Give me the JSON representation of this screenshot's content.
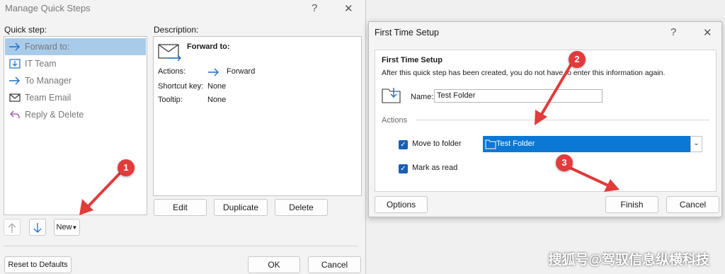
{
  "manage_dialog": {
    "title": "Manage Quick Steps",
    "help": "?",
    "close": "✕",
    "quick_step_label": "Quick step:",
    "description_label": "Description:",
    "quick_steps": [
      {
        "label": "Forward to:",
        "icon": "forward-arrow-icon"
      },
      {
        "label": "IT Team",
        "icon": "move-to-folder-icon"
      },
      {
        "label": "To Manager",
        "icon": "forward-arrow-icon"
      },
      {
        "label": "Team Email",
        "icon": "envelope-icon"
      },
      {
        "label": "Reply & Delete",
        "icon": "reply-icon"
      }
    ],
    "description": {
      "title": "Forward to:",
      "actions_label": "Actions:",
      "action_value": "Forward",
      "shortcut_label": "Shortcut key:",
      "shortcut_value": "None",
      "tooltip_label": "Tooltip:",
      "tooltip_value": "None"
    },
    "buttons": {
      "edit": "Edit",
      "duplicate": "Duplicate",
      "delete": "Delete",
      "new": "New",
      "reset": "Reset to Defaults",
      "ok": "OK",
      "cancel": "Cancel"
    }
  },
  "setup_dialog": {
    "title": "First Time Setup",
    "help": "?",
    "close": "✕",
    "heading": "First Time Setup",
    "subtext": "After this quick step has been created, you do not have to enter this information again.",
    "name_label": "Name:",
    "name_value": "Test Folder",
    "actions_label": "Actions",
    "move_to_folder_label": "Move to folder",
    "folder_value": "Test Folder",
    "mark_as_read_label": "Mark as read",
    "buttons": {
      "options": "Options",
      "finish": "Finish",
      "cancel": "Cancel"
    }
  },
  "callouts": [
    "1",
    "2",
    "3"
  ],
  "watermark": "搜狐号@驾驭信息纵横科技",
  "colors": {
    "accent": "#0a78d4",
    "selection": "#a9cbea",
    "callout": "#e23b3b"
  }
}
